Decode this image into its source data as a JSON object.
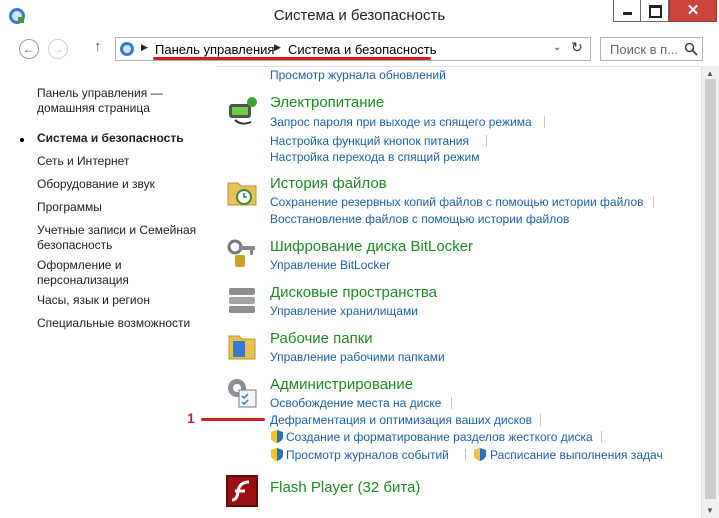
{
  "window": {
    "title": "Система и безопасность",
    "close_glyph": "✕",
    "accent_color": "#1f8a24",
    "link_color": "#1d5fa8",
    "annotation_color": "#d21e1e"
  },
  "address": {
    "crumbs": [
      "Панель управления",
      "Система и безопасность"
    ],
    "search_placeholder": "Поиск в п..."
  },
  "sidebar": {
    "items": [
      "Панель управления — домашняя страница",
      "Система и безопасность",
      "Сеть и Интернет",
      "Оборудование и звук",
      "Программы",
      "Учетные записи и Семейная безопасность",
      "Оформление и персонализация",
      "Часы, язык и регион",
      "Специальные возможности"
    ],
    "active_index": 1
  },
  "sections": {
    "top_link": "Просмотр журнала обновлений",
    "power": {
      "title": "Электропитание",
      "links": [
        "Запрос пароля при выходе из спящего режима",
        "Настройка функций кнопок питания",
        "Настройка перехода в спящий режим"
      ]
    },
    "history": {
      "title": "История файлов",
      "links": [
        "Сохранение резервных копий файлов с помощью истории файлов",
        "Восстановление файлов с помощью истории файлов"
      ]
    },
    "bitlocker": {
      "title": "Шифрование диска BitLocker",
      "links": [
        "Управление BitLocker"
      ]
    },
    "storage": {
      "title": "Дисковые пространства",
      "links": [
        "Управление хранилищами"
      ]
    },
    "workfolders": {
      "title": "Рабочие папки",
      "links": [
        "Управление рабочими папками"
      ]
    },
    "admin": {
      "title": "Администрирование",
      "links": [
        "Освобождение места на диске",
        "Дефрагментация и оптимизация ваших дисков",
        "Создание и форматирование разделов жесткого диска",
        "Просмотр журналов событий",
        "Расписание выполнения задач"
      ]
    },
    "flash": {
      "title": "Flash Player (32 бита)"
    }
  },
  "annotation": {
    "number": "1"
  },
  "icons": [
    "control-panel-icon",
    "back-arrow-icon",
    "forward-arrow-icon",
    "up-arrow-icon",
    "refresh-icon",
    "search-icon",
    "power-icon",
    "file-history-icon",
    "bitlocker-keys-icon",
    "storage-spaces-icon",
    "work-folders-icon",
    "admin-tools-icon",
    "shield-icon",
    "flash-icon"
  ]
}
